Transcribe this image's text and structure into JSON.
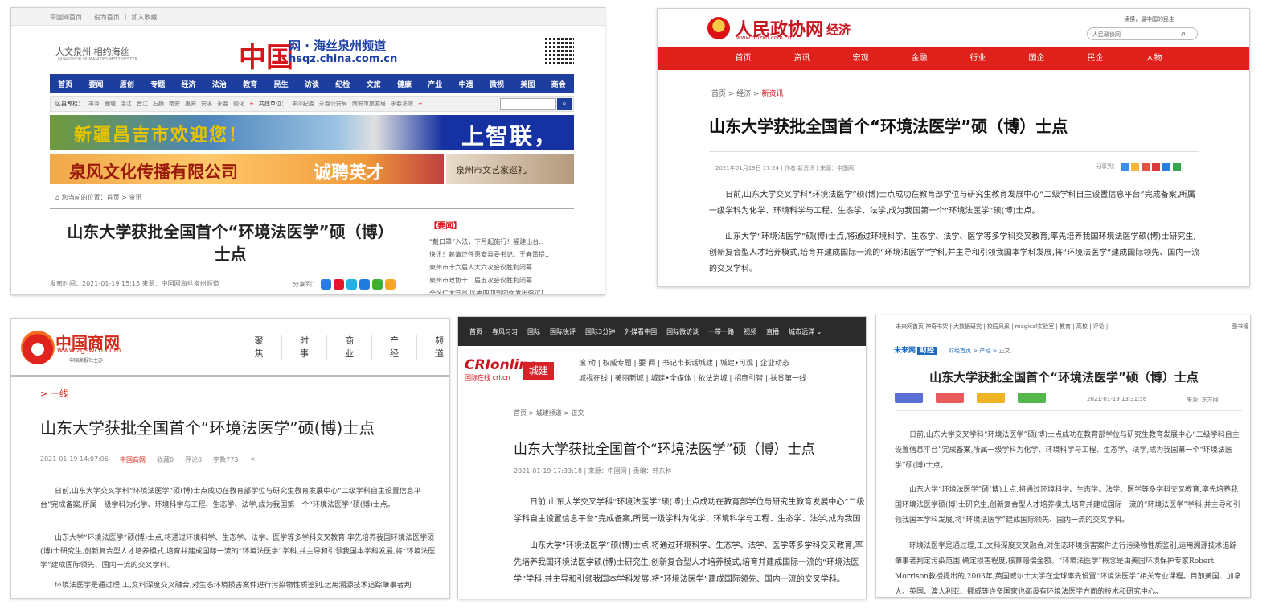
{
  "panelA": {
    "toplinks": [
      "中国网首页",
      "|",
      "设为首页",
      "|",
      "加入收藏"
    ],
    "motto": "人文泉州  相约海丝",
    "motto_en": "QUANZHOU HUMANITIES MEET HESTER",
    "brand": "中国",
    "brand_title": "网 · 海丝泉州频道",
    "brand_url": "hsqz.china.com.cn",
    "nav": [
      "首页",
      "要闻",
      "原创",
      "专题",
      "经济",
      "法治",
      "教育",
      "民生",
      "访谈",
      "纪检",
      "文旅",
      "健康",
      "产业",
      "中遗",
      "微视",
      "美图",
      "商会"
    ],
    "subnav_label1": "区县专栏：",
    "subnav_items1": [
      "丰泽",
      "鲤城",
      "洛江",
      "晋江",
      "石狮",
      "南安",
      "惠安",
      "安溪",
      "永春",
      "德化"
    ],
    "subnav_label2": "共建单位：",
    "subnav_items2": [
      "丰泽纪委",
      "永春公安局",
      "南安市旅游局",
      "永春法院"
    ],
    "plus": "+",
    "search_icon": "⌕",
    "banner1_text": "新疆昌吉市欢迎您！",
    "banner1_right": "上智联，",
    "banner2_text": "泉风文化传播有限公司",
    "banner2_right": "诚聘英才",
    "banner3_text": "泉州市文艺家巡礼",
    "crumb": "⌂ 您当前的位置：首页 > 资讯",
    "title": "山东大学获批全国首个“环境法医学”硕（博）士点",
    "meta": "发布时间：2021-01-19 15:15  来源：中国网海丝泉州频道",
    "share_label": "分享到：",
    "side_title": "【要闻】",
    "side_items": [
      "“戴口罩”入法，下月起施行！福建出台..",
      "快讯！赖清正任惠安县委书记，王春雷提..",
      "泉州市十六届人大六次会议胜利闭幕",
      "泉州市政协十二届五次会议胜利闭幕",
      "全区仁大党员 区委四四部向你发出倡议！"
    ]
  },
  "panelB": {
    "site_name": "人民政协网",
    "site_url": "www.rmzxb.com.cn",
    "section": "经济",
    "slogan": "读懂，最中国的民主",
    "search_placeholder": "人民政协网",
    "search_icon": "⌕",
    "nav": [
      "首页",
      "资讯",
      "宏观",
      "金融",
      "行业",
      "国企",
      "民企",
      "人物"
    ],
    "crumb_home": "首页 > 经济 > ",
    "crumb_current": "新资讯",
    "title": "山东大学获批全国首个“环境法医学”硕（博）士点",
    "meta": "2021年01月19日 17:24 | 作者:新资讯 | 来源：中国网",
    "share_label": "分享到：",
    "para1": "日前,山东大学交叉学科“环境法医学”硕(博)士点成功在教育部学位与研究生教育发展中心“二级学科自主设置信息平台”完成备案,所属一级学科为化学、环境科学与工程、生态学、法学,成为我国第一个“环境法医学”硕(博)士点。",
    "para2": "山东大学“环境法医学”硕(博)士点,将通过环境科学、生态学、法学、医学等多学科交叉教育,率先培养我国环境法医学硕(博)士研究生,创新复合型人才培养模式,培育并建成国际一流的“环境法医学”学科,并主导和引领我国本学科发展,将“环境法医学”建成国际领先、国内一流的交叉学科。"
  },
  "panelC": {
    "site_name": "中国商网",
    "site_url": "www.zgswcn.com",
    "site_sub": "中国商报社主办",
    "nav": [
      "聚焦",
      "时事",
      "商业",
      "产经",
      "频道"
    ],
    "tag": "> 一线",
    "title": "山东大学获批全国首个“环境法医学”硕(博)士点",
    "meta_date": "2021-01-19 14:07:06",
    "meta_src": "中国商网",
    "meta_fav": "收藏0",
    "meta_comment": "评论0",
    "meta_words": "字数773",
    "share_icon": "⋖",
    "para1": "日前,山东大学交叉学科“环境法医学”硕(博)士点成功在教育部学位与研究生教育发展中心“二级学科自主设置信息平台”完成备案,所属一级学科为化学、环境科学与工程、生态学、法学,成为我国第一个“环境法医学”硕(博)士点。",
    "para2": "山东大学“环境法医学”硕(博)士点,将通过环境科学、生态学、法学、医学等多学科交叉教育,率先培养我国环境法医学硕(博)士研究生,创新复合型人才培养模式,培育并建成国际一流的“环境法医学”学科,并主导和引领我国本学科发展,将“环境法医学”建成国际领先、国内一流的交叉学科。",
    "para3": "环境法医学是通过理,工,文科深度交叉融合,对生态环境损害案件进行污染物性质鉴别,运用溯源技术追踪肇事者判"
  },
  "panelD": {
    "topnav": [
      "首页",
      "春风习习",
      "国际",
      "国际锐评",
      "国际3分钟",
      "外媒看中国",
      "国际微访谈",
      "一带一路",
      "视频",
      "直播",
      "城市远洋 ⌄"
    ],
    "logo": "CRIonline",
    "logo_sub": "国际在线 cri.cn",
    "logo_box": "城建",
    "subnav1": "滚 动  |  权威专题  |  要 闻  |  书记市长话城建  |  城建•可观  |  企业动态",
    "subnav2": "城视在线  |  美丽新城  |  城建•全媒体  |  依法治城  |  招商引智  |  扶贫第一线",
    "crumb": "首页 > 城建频道 > 正文",
    "title": "山东大学获批全国首个“环境法医学”硕（博）士点",
    "meta": "2021-01-19 17:33:18  |  来源：中国网  |  责编：韩东林",
    "para1": "日前,山东大学交叉学科“环境法医学”硕(博)士点成功在教育部学位与研究生教育发展中心“二级学科自主设置信息平台”完成备案,所属一级学科为化学、环境科学与工程、生态学、法学,成为我国第一个“环境法",
    "para2": "山东大学“环境法医学”硕(博)士点,将通过环境科学、生态学、法学、医学等多学科交叉教育,率先培养我国环境法医学硕(博)士研究生,创新复合型人才培养模式,培育并建成国际一流的“环境法医学”学科,并主导和引领我国本学科发展,将“环境法医学”建成国际领先、国内一流的交叉学科。"
  },
  "panelE": {
    "toplinks": "未来网首页  神奇书架 | 大数据研究 | 校园风采 | magical实验室 | 教育 | 高校 | 评论 |",
    "top_right": "图书榜",
    "logo": "未来网",
    "logo_tag": "财经",
    "crumb_a": "财经首页 > 产经 > ",
    "crumb_b": "正文",
    "title": "山东大学获批全国首个“环境法医学”硕（博）士点",
    "date": "2021-01-19 13:31:56",
    "src": "来源: 东方网",
    "btn_colors": [
      "#5a6fd6",
      "#e85b5b",
      "#f0b323",
      "#54b84a"
    ],
    "para1": "日前,山东大学交叉学科“环境法医学”硕(博)士点成功在教育部学位与研究生教育发展中心“二级学科自主设置信息平台”完成备案,所属一级学科为化学、环境科学与工程、生态学、法学,成为我国第一个“环境法医学”硕(博)士点。",
    "para2": "山东大学“环境法医学”硕(博)士点,将通过环境科学、生态学、法学、医学等多学科交叉教育,率先培养我国环境法医学硕(博)士研究生,创新复合型人才培养模式,培育并建成国际一流的“环境法医学”学科,并主导和引领我国本学科发展,将“环境法医学”建成国际领先、国内一流的交叉学科。",
    "para3": "环境法医学是通过理,工,文科深度交叉融合,对生态环境损害案件进行污染物性质鉴别,运用溯源技术追踪肇事者判定污染范围,确定损害程度,核算赔偿金额。“环境法医学”概念是由美国环境保护专家Robert Morrison教授提出的,2003年,英国威尔士大学在全球率先设置“环境法医学”相关专业课程。目前美国、加拿大、英国、澳大利亚、挪威等许多国家也都设有环境法医学方面的技术和研究中心。"
  }
}
